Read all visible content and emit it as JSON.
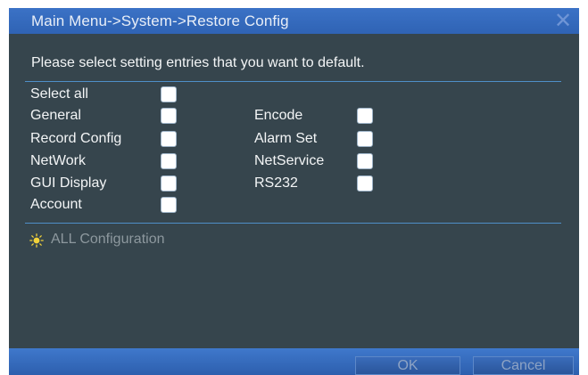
{
  "window": {
    "title": "Main Menu->System->Restore Config",
    "close_icon": "close-icon"
  },
  "instruction": "Please select setting entries that you want to default.",
  "options_left": [
    {
      "label": "Select all",
      "checked": false
    },
    {
      "label": "General",
      "checked": false
    },
    {
      "label": "Record Config",
      "checked": false
    },
    {
      "label": "NetWork",
      "checked": false
    },
    {
      "label": "GUI Display",
      "checked": false
    },
    {
      "label": "Account",
      "checked": false
    }
  ],
  "options_right": [
    {
      "label": "Encode",
      "checked": false
    },
    {
      "label": "Alarm Set",
      "checked": false
    },
    {
      "label": "NetService",
      "checked": false
    },
    {
      "label": "RS232",
      "checked": false
    }
  ],
  "all_config": {
    "icon": "lightbulb-icon",
    "label": "ALL Configuration"
  },
  "footer": {
    "ok_label": "OK",
    "cancel_label": "Cancel"
  },
  "colors": {
    "titlebar": "#3b72c6",
    "panel": "#36454d",
    "divider": "#4f8fc8"
  }
}
